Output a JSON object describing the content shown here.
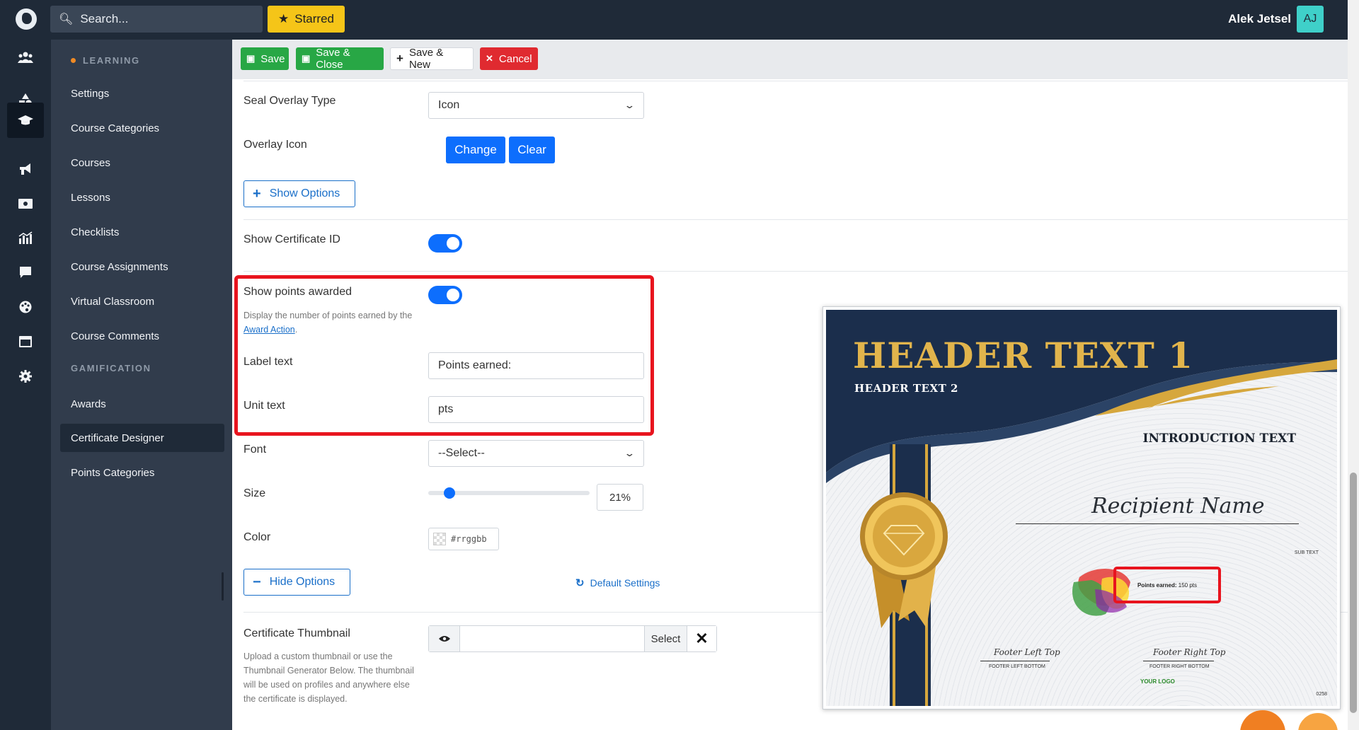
{
  "topbar": {
    "search_placeholder": "Search...",
    "starred_label": "Starred",
    "user_name": "Alek Jetsel",
    "user_initials": "AJ"
  },
  "rail": {
    "icons": [
      "users-icon",
      "shapes-icon",
      "graduation-cap-icon",
      "megaphone-icon",
      "money-bill-icon",
      "chart-icon",
      "chat-icon",
      "palette-icon",
      "window-icon",
      "gear-icon"
    ],
    "active_index": 2
  },
  "sidebar": {
    "section_learning": "LEARNING",
    "learning_items": [
      {
        "label": "Settings"
      },
      {
        "label": "Course Categories"
      },
      {
        "label": "Courses"
      },
      {
        "label": "Lessons"
      },
      {
        "label": "Checklists"
      },
      {
        "label": "Course Assignments"
      },
      {
        "label": "Virtual Classroom"
      },
      {
        "label": "Course Comments"
      }
    ],
    "section_gamification": "GAMIFICATION",
    "gamification_items": [
      {
        "label": "Awards"
      },
      {
        "label": "Certificate Designer",
        "active": true
      },
      {
        "label": "Points Categories"
      }
    ]
  },
  "toolbar": {
    "save_label": "Save",
    "save_close_label": "Save & Close",
    "save_new_label": "Save & New",
    "cancel_label": "Cancel"
  },
  "form": {
    "seal_overlay_type": {
      "label": "Seal Overlay Type",
      "value": "Icon"
    },
    "overlay_icon": {
      "label": "Overlay Icon",
      "change_label": "Change",
      "clear_label": "Clear"
    },
    "show_options_label": "Show Options",
    "show_certificate_id": {
      "label": "Show Certificate ID",
      "enabled": true
    },
    "show_points_awarded": {
      "label": "Show points awarded",
      "enabled": true,
      "help_before": "Display the number of points earned by the ",
      "help_link": "Award Action",
      "help_after": "."
    },
    "label_text": {
      "label": "Label text",
      "value": "Points earned:"
    },
    "unit_text": {
      "label": "Unit text",
      "value": "pts"
    },
    "font": {
      "label": "Font",
      "value": "--Select--"
    },
    "size": {
      "label": "Size",
      "value": "21%",
      "fraction": 0.21
    },
    "color": {
      "label": "Color",
      "placeholder": "#rrggbb"
    },
    "hide_options_label": "Hide Options",
    "default_settings_label": "Default Settings",
    "certificate_thumbnail": {
      "label": "Certificate Thumbnail",
      "help": "Upload a custom thumbnail or use the Thumbnail Generator Below. The thumbnail will be used on profiles and anywhere else the certificate is displayed.",
      "select_label": "Select"
    }
  },
  "certificate": {
    "header1": "HEADER TEXT 1",
    "header2": "HEADER TEXT 2",
    "intro": "INTRODUCTION TEXT",
    "recipient": "Recipient Name",
    "sub_text": "SUB TEXT",
    "points_label": "Points earned:",
    "points_value": " 150 pts",
    "footer_left_top": "Footer Left Top",
    "footer_left_bottom": "FOOTER LEFT BOTTOM",
    "footer_right_top": "Footer Right Top",
    "footer_right_bottom": "FOOTER RIGHT BOTTOM",
    "logo_text": "YOUR LOGO",
    "code": "0258"
  },
  "colors": {
    "topbar": "#1f2a38",
    "sidebar": "#313c4c",
    "primary": "#0d6efd",
    "success": "#28a745",
    "danger": "#e02a30",
    "highlight": "#e8141e",
    "starred": "#f5c518",
    "avatar": "#3fd0c9",
    "cert_navy": "#1b2e4c",
    "cert_gold": "#e1b44c"
  }
}
